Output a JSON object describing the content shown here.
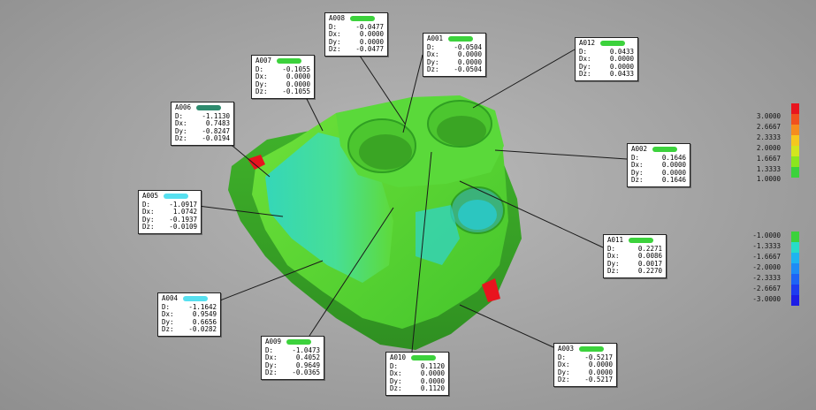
{
  "annotations": [
    {
      "id": "A008",
      "tag_color": "#3cd23c",
      "rows": [
        [
          "D:",
          "-0.0477"
        ],
        [
          "Dx:",
          "0.0000"
        ],
        [
          "Dy:",
          "0.0000"
        ],
        [
          "Dz:",
          "-0.0477"
        ]
      ]
    },
    {
      "id": "A001",
      "tag_color": "#3cd23c",
      "rows": [
        [
          "D:",
          "-0.0504"
        ],
        [
          "Dx:",
          "0.0000"
        ],
        [
          "Dy:",
          "0.0000"
        ],
        [
          "Dz:",
          "-0.0504"
        ]
      ]
    },
    {
      "id": "A012",
      "tag_color": "#3cd23c",
      "rows": [
        [
          "D:",
          "0.0433"
        ],
        [
          "Dx:",
          "0.0000"
        ],
        [
          "Dy:",
          "0.0000"
        ],
        [
          "Dz:",
          "0.0433"
        ]
      ]
    },
    {
      "id": "A007",
      "tag_color": "#3cd23c",
      "rows": [
        [
          "D:",
          "-0.1055"
        ],
        [
          "Dx:",
          "0.0000"
        ],
        [
          "Dy:",
          "0.0000"
        ],
        [
          "Dz:",
          "-0.1055"
        ]
      ]
    },
    {
      "id": "A006",
      "tag_color": "#2e8b6e",
      "rows": [
        [
          "D:",
          "-1.1130"
        ],
        [
          "Dx:",
          "0.7483"
        ],
        [
          "Dy:",
          "-0.8247"
        ],
        [
          "Dz:",
          "-0.0194"
        ]
      ]
    },
    {
      "id": "A002",
      "tag_color": "#3cd23c",
      "rows": [
        [
          "D:",
          "0.1646"
        ],
        [
          "Dx:",
          "0.0000"
        ],
        [
          "Dy:",
          "0.0000"
        ],
        [
          "Dz:",
          "0.1646"
        ]
      ]
    },
    {
      "id": "A005",
      "tag_color": "#56e0f0",
      "rows": [
        [
          "D:",
          "-1.0917"
        ],
        [
          "Dx:",
          "1.0742"
        ],
        [
          "Dy:",
          "-0.1937"
        ],
        [
          "Dz:",
          "-0.0109"
        ]
      ]
    },
    {
      "id": "A011",
      "tag_color": "#3cd23c",
      "rows": [
        [
          "D:",
          "0.2271"
        ],
        [
          "Dx:",
          "0.0086"
        ],
        [
          "Dy:",
          "0.0017"
        ],
        [
          "Dz:",
          "0.2270"
        ]
      ]
    },
    {
      "id": "A004",
      "tag_color": "#56e0f0",
      "rows": [
        [
          "D:",
          "-1.1642"
        ],
        [
          "Dx:",
          "0.9549"
        ],
        [
          "Dy:",
          "0.6656"
        ],
        [
          "Dz:",
          "-0.0282"
        ]
      ]
    },
    {
      "id": "A009",
      "tag_color": "#3cd23c",
      "rows": [
        [
          "D:",
          "-1.0473"
        ],
        [
          "Dx:",
          "0.4052"
        ],
        [
          "Dy:",
          "0.9649"
        ],
        [
          "Dz:",
          "-0.0365"
        ]
      ]
    },
    {
      "id": "A010",
      "tag_color": "#3cd23c",
      "rows": [
        [
          "D:",
          "0.1120"
        ],
        [
          "Dx:",
          "0.0000"
        ],
        [
          "Dy:",
          "0.0000"
        ],
        [
          "Dz:",
          "0.1120"
        ]
      ]
    },
    {
      "id": "A003",
      "tag_color": "#3cd23c",
      "rows": [
        [
          "D:",
          "-0.5217"
        ],
        [
          "Dx:",
          "0.0000"
        ],
        [
          "Dy:",
          "0.0000"
        ],
        [
          "Dz:",
          "-0.5217"
        ]
      ]
    }
  ],
  "legend": {
    "labels": [
      "3.0000",
      "2.6667",
      "2.3333",
      "2.0000",
      "1.6667",
      "1.3333",
      "1.0000",
      "-1.0000",
      "-1.3333",
      "-1.6667",
      "-2.0000",
      "-2.3333",
      "-2.6667",
      "-3.0000"
    ],
    "colors": [
      "#e8141e",
      "#f0501e",
      "#f58c1e",
      "#f5c81e",
      "#d2e61e",
      "#8ce61e",
      "#3cd23c",
      "#28dcc8",
      "#1eb4f0",
      "#1e8cf5",
      "#1e64f5",
      "#1e3cf0",
      "#1e1ee6"
    ]
  }
}
